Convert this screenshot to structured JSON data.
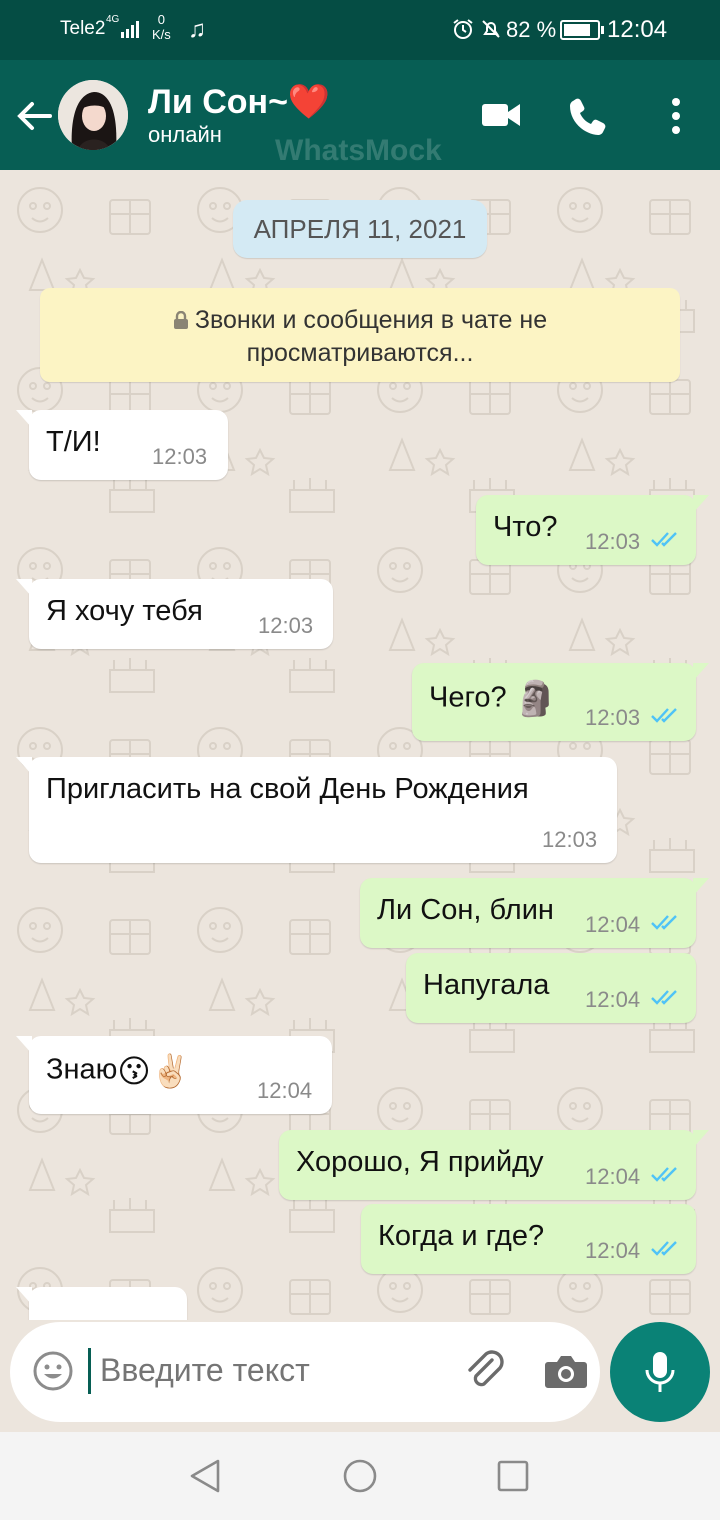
{
  "status_bar": {
    "carrier": "Tele2",
    "network": "4G",
    "speed_value": "0",
    "speed_unit": "K/s",
    "battery_percent": "82 %",
    "battery_level": 0.82,
    "clock": "12:04"
  },
  "header": {
    "contact_name": "Ли Сон~",
    "contact_heart": "❤️",
    "presence": "онлайн",
    "watermark": "WhatsMock",
    "accent": "#075e54"
  },
  "chat": {
    "date_chip": "АПРЕЛЯ 11, 2021",
    "encryption_notice_line1": "Звонки и сообщения в чате не",
    "encryption_notice_line2": "просматриваются...",
    "messages": [
      {
        "direction": "in",
        "text": "Т/И!",
        "time": "12:03"
      },
      {
        "direction": "out",
        "text": "Что?",
        "time": "12:03",
        "status": "read"
      },
      {
        "direction": "in",
        "text": "Я хочу тебя",
        "time": "12:03"
      },
      {
        "direction": "out",
        "text": "Чего?",
        "emoji": "🗿",
        "time": "12:03",
        "status": "read"
      },
      {
        "direction": "in",
        "text": "Пригласить на свой День Рождения",
        "time": "12:03"
      },
      {
        "direction": "out",
        "text": "Ли Сон, блин",
        "time": "12:04",
        "status": "read"
      },
      {
        "direction": "out",
        "text": "Напугала",
        "time": "12:04",
        "status": "read"
      },
      {
        "direction": "in",
        "text": "Знаю",
        "emoji": "😗✌🏻",
        "time": "12:04"
      },
      {
        "direction": "out",
        "text": "Хорошо, Я прийду",
        "time": "12:04",
        "status": "read"
      },
      {
        "direction": "out",
        "text": "Когда и где?",
        "time": "12:04",
        "status": "read"
      }
    ]
  },
  "composer": {
    "placeholder": "Введите текст"
  }
}
